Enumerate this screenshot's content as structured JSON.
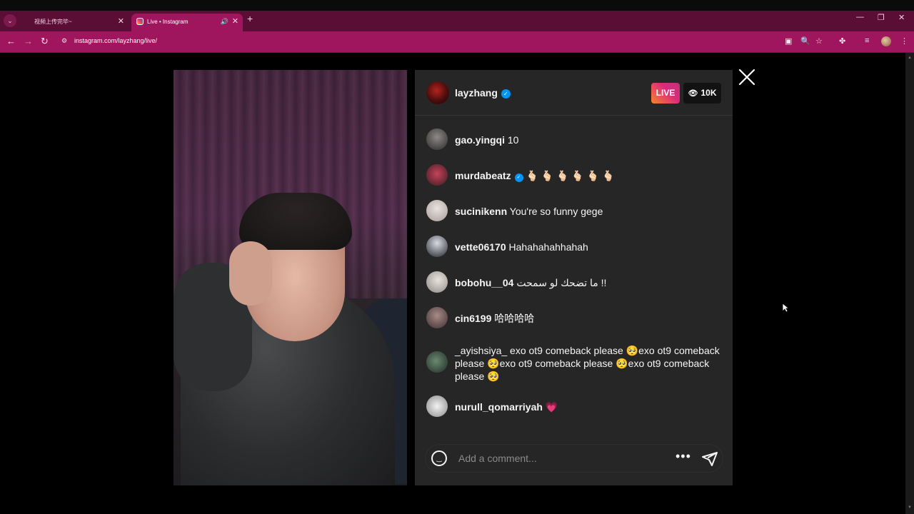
{
  "browser": {
    "tabs": [
      {
        "title": "视频上传完毕~",
        "active": false
      },
      {
        "title": "Live • Instagram",
        "active": true
      }
    ],
    "url": "instagram.com/layzhang/live/",
    "accent": "#a0165e"
  },
  "live": {
    "host": "layzhang",
    "verified": true,
    "badge": "LIVE",
    "viewers": "10K",
    "badge_color": "#dd2a7b"
  },
  "comments": [
    {
      "user": "gao.yingqi",
      "text": "10",
      "verified": false
    },
    {
      "user": "murdabeatz",
      "text": "🫰🏻 🫰🏻 🫰🏻 🫰🏻 🫰🏻 🫰🏻",
      "verified": true
    },
    {
      "user": "sucinikenn",
      "text": "You're so funny gege",
      "verified": false
    },
    {
      "user": "vette06170",
      "text": "Hahahahahhahah",
      "verified": false
    },
    {
      "user": "bobohu__04",
      "text": "ما تضحك لو سمحت !!",
      "verified": false
    },
    {
      "user": "cin6199",
      "text": "哈哈哈哈",
      "verified": false
    },
    {
      "user": "_ayishsiya_",
      "text": "exo ot9 comeback please 🥺exo ot9 comeback please 🥺exo ot9 comeback please 🥺exo ot9 comeback please 🥺",
      "verified": false
    },
    {
      "user": "nurull_qomarriyah",
      "text": "💗",
      "verified": false
    }
  ],
  "composer": {
    "placeholder": "Add a comment..."
  }
}
